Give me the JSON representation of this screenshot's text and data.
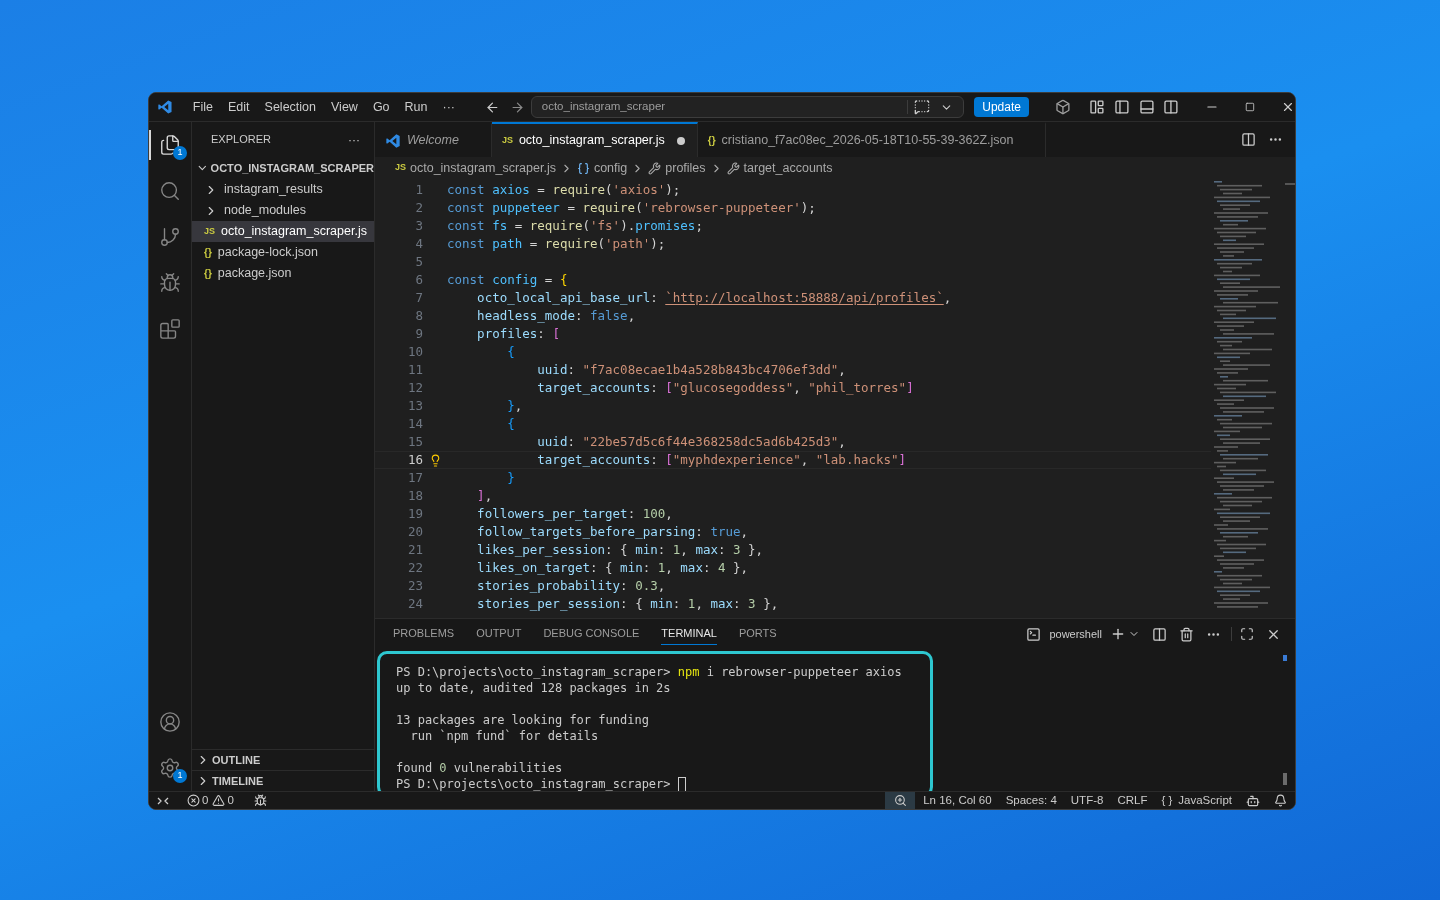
{
  "title_bar": {
    "menu": [
      "File",
      "Edit",
      "Selection",
      "View",
      "Go",
      "Run",
      "···"
    ],
    "command_center": "octo_instagram_scraper",
    "update_button": "Update"
  },
  "activity_bar": {
    "top": [
      {
        "kind": "files",
        "badge": "1",
        "selected": true
      },
      {
        "kind": "search",
        "selected": false
      },
      {
        "kind": "source-control",
        "selected": false
      },
      {
        "kind": "run-debug",
        "selected": false
      },
      {
        "kind": "extensions",
        "selected": false
      }
    ],
    "bottom": [
      {
        "kind": "account"
      },
      {
        "kind": "settings",
        "badge": "1"
      }
    ]
  },
  "sidebar": {
    "title": "EXPLORER",
    "more": "···",
    "root": {
      "label": "OCTO_INSTAGRAM_SCRAPER",
      "expanded": true,
      "children": [
        {
          "label": "instagram_results",
          "kind": "folder",
          "expanded": false,
          "selected": false
        },
        {
          "label": "node_modules",
          "kind": "folder",
          "expanded": false,
          "selected": false
        },
        {
          "label": "octo_instagram_scraper.js",
          "kind": "js",
          "badge": "JS",
          "selected": true
        },
        {
          "label": "package-lock.json",
          "kind": "json",
          "badge": "{}",
          "selected": false
        },
        {
          "label": "package.json",
          "kind": "json",
          "badge": "{}",
          "selected": false
        }
      ]
    },
    "sections": [
      {
        "label": "OUTLINE",
        "expanded": false
      },
      {
        "label": "TIMELINE",
        "expanded": false
      }
    ]
  },
  "tabs": [
    {
      "label": "Welcome",
      "kind": "welcome",
      "selected": false,
      "modified": false
    },
    {
      "label": "octo_instagram_scraper.js",
      "kind": "js",
      "badge": "JS",
      "selected": true,
      "modified": true
    },
    {
      "label": "cristiano_f7ac08ec_2026-05-18T10-55-39-362Z.json",
      "kind": "json",
      "badge": "{}",
      "selected": false,
      "modified": false
    }
  ],
  "breadcrumb": [
    {
      "label": "octo_instagram_scraper.js",
      "kind": "js",
      "badge": "JS"
    },
    {
      "label": "config",
      "kind": "variable"
    },
    {
      "label": "profiles",
      "kind": "property"
    },
    {
      "label": "target_accounts",
      "kind": "property"
    }
  ],
  "code": [
    {
      "number": "1",
      "current": false,
      "tokens": [
        {
          "kind": "keyword",
          "text": "const "
        },
        {
          "kind": "var",
          "text": "axios"
        },
        {
          "kind": "punct",
          "text": " = "
        },
        {
          "kind": "fn",
          "text": "require"
        },
        {
          "kind": "punct",
          "text": "("
        },
        {
          "kind": "str",
          "text": "'axios'"
        },
        {
          "kind": "punct",
          "text": ");"
        }
      ]
    },
    {
      "number": "2",
      "current": false,
      "tokens": [
        {
          "kind": "keyword",
          "text": "const "
        },
        {
          "kind": "var",
          "text": "puppeteer"
        },
        {
          "kind": "punct",
          "text": " = "
        },
        {
          "kind": "fn",
          "text": "require"
        },
        {
          "kind": "punct",
          "text": "("
        },
        {
          "kind": "str",
          "text": "'rebrowser-puppeteer'"
        },
        {
          "kind": "punct",
          "text": ");"
        }
      ]
    },
    {
      "number": "3",
      "current": false,
      "tokens": [
        {
          "kind": "keyword",
          "text": "const "
        },
        {
          "kind": "var",
          "text": "fs"
        },
        {
          "kind": "punct",
          "text": " = "
        },
        {
          "kind": "fn",
          "text": "require"
        },
        {
          "kind": "punct",
          "text": "("
        },
        {
          "kind": "str",
          "text": "'fs'"
        },
        {
          "kind": "punct",
          "text": ")."
        },
        {
          "kind": "var",
          "text": "promises"
        },
        {
          "kind": "punct",
          "text": ";"
        }
      ]
    },
    {
      "number": "4",
      "current": false,
      "tokens": [
        {
          "kind": "keyword",
          "text": "const "
        },
        {
          "kind": "var",
          "text": "path"
        },
        {
          "kind": "punct",
          "text": " = "
        },
        {
          "kind": "fn",
          "text": "require"
        },
        {
          "kind": "punct",
          "text": "("
        },
        {
          "kind": "str",
          "text": "'path'"
        },
        {
          "kind": "punct",
          "text": ");"
        }
      ]
    },
    {
      "number": "5",
      "current": false
    },
    {
      "number": "6",
      "current": false,
      "tokens": [
        {
          "kind": "keyword",
          "text": "const "
        },
        {
          "kind": "var",
          "text": "config"
        },
        {
          "kind": "punct",
          "text": " = "
        },
        {
          "kind": "brace",
          "text": "{"
        }
      ]
    },
    {
      "number": "7",
      "current": false,
      "tokens": [
        {
          "kind": "prop",
          "text": "    octo_local_api_base_url"
        },
        {
          "kind": "punct",
          "text": ": "
        },
        {
          "kind": "link",
          "text": "`http://localhost:58888/api/profiles`"
        },
        {
          "kind": "punct",
          "text": ","
        }
      ]
    },
    {
      "number": "8",
      "current": false,
      "tokens": [
        {
          "kind": "prop",
          "text": "    headless_mode"
        },
        {
          "kind": "punct",
          "text": ": "
        },
        {
          "kind": "bool",
          "text": "false"
        },
        {
          "kind": "punct",
          "text": ","
        }
      ]
    },
    {
      "number": "9",
      "current": false,
      "tokens": [
        {
          "kind": "prop",
          "text": "    profiles"
        },
        {
          "kind": "punct",
          "text": ": "
        },
        {
          "kind": "bracket",
          "text": "["
        }
      ]
    },
    {
      "number": "10",
      "current": false,
      "tokens": [
        {
          "kind": "brace2",
          "text": "        {"
        }
      ]
    },
    {
      "number": "11",
      "current": false,
      "tokens": [
        {
          "kind": "prop",
          "text": "            uuid"
        },
        {
          "kind": "punct",
          "text": ": "
        },
        {
          "kind": "str",
          "text": "\"f7ac08ecae1b4a528b843bc4706ef3dd\""
        },
        {
          "kind": "punct",
          "text": ","
        }
      ]
    },
    {
      "number": "12",
      "current": false,
      "tokens": [
        {
          "kind": "prop",
          "text": "            target_accounts"
        },
        {
          "kind": "punct",
          "text": ": "
        },
        {
          "kind": "bracket",
          "text": "["
        },
        {
          "kind": "str",
          "text": "\"glucosegoddess\""
        },
        {
          "kind": "punct",
          "text": ", "
        },
        {
          "kind": "str",
          "text": "\"phil_torres\""
        },
        {
          "kind": "bracket",
          "text": "]"
        }
      ]
    },
    {
      "number": "13",
      "current": false,
      "tokens": [
        {
          "kind": "brace2",
          "text": "        }"
        },
        {
          "kind": "punct",
          "text": ","
        }
      ]
    },
    {
      "number": "14",
      "current": false,
      "tokens": [
        {
          "kind": "brace2",
          "text": "        {"
        }
      ]
    },
    {
      "number": "15",
      "current": false,
      "tokens": [
        {
          "kind": "prop",
          "text": "            uuid"
        },
        {
          "kind": "punct",
          "text": ": "
        },
        {
          "kind": "str",
          "text": "\"22be57d5c6f44e368258dc5ad6b425d3\""
        },
        {
          "kind": "punct",
          "text": ","
        }
      ]
    },
    {
      "number": "16",
      "current": true,
      "tokens": [
        {
          "kind": "prop",
          "text": "            target_accounts"
        },
        {
          "kind": "punct",
          "text": ": "
        },
        {
          "kind": "bracket",
          "text": "["
        },
        {
          "kind": "str",
          "text": "\"myphdexperience\""
        },
        {
          "kind": "punct",
          "text": ", "
        },
        {
          "kind": "str",
          "text": "\"lab.hacks\""
        },
        {
          "kind": "bracket",
          "text": "]"
        }
      ]
    },
    {
      "number": "17",
      "current": false,
      "tokens": [
        {
          "kind": "brace2",
          "text": "        }"
        }
      ]
    },
    {
      "number": "18",
      "current": false,
      "tokens": [
        {
          "kind": "bracket",
          "text": "    ]"
        },
        {
          "kind": "punct",
          "text": ","
        }
      ]
    },
    {
      "number": "19",
      "current": false,
      "tokens": [
        {
          "kind": "prop",
          "text": "    followers_per_target"
        },
        {
          "kind": "punct",
          "text": ": "
        },
        {
          "kind": "num",
          "text": "100"
        },
        {
          "kind": "punct",
          "text": ","
        }
      ]
    },
    {
      "number": "20",
      "current": false,
      "tokens": [
        {
          "kind": "prop",
          "text": "    follow_targets_before_parsing"
        },
        {
          "kind": "punct",
          "text": ": "
        },
        {
          "kind": "bool",
          "text": "true"
        },
        {
          "kind": "punct",
          "text": ","
        }
      ]
    },
    {
      "number": "21",
      "current": false,
      "tokens": [
        {
          "kind": "prop",
          "text": "    likes_per_session"
        },
        {
          "kind": "punct",
          "text": ": { "
        },
        {
          "kind": "prop",
          "text": "min"
        },
        {
          "kind": "punct",
          "text": ": "
        },
        {
          "kind": "num",
          "text": "1"
        },
        {
          "kind": "punct",
          "text": ", "
        },
        {
          "kind": "prop",
          "text": "max"
        },
        {
          "kind": "punct",
          "text": ": "
        },
        {
          "kind": "num",
          "text": "3"
        },
        {
          "kind": "punct",
          "text": " },"
        }
      ]
    },
    {
      "number": "22",
      "current": false,
      "tokens": [
        {
          "kind": "prop",
          "text": "    likes_on_target"
        },
        {
          "kind": "punct",
          "text": ": { "
        },
        {
          "kind": "prop",
          "text": "min"
        },
        {
          "kind": "punct",
          "text": ": "
        },
        {
          "kind": "num",
          "text": "1"
        },
        {
          "kind": "punct",
          "text": ", "
        },
        {
          "kind": "prop",
          "text": "max"
        },
        {
          "kind": "punct",
          "text": ": "
        },
        {
          "kind": "num",
          "text": "4"
        },
        {
          "kind": "punct",
          "text": " },"
        }
      ]
    },
    {
      "number": "23",
      "current": false,
      "tokens": [
        {
          "kind": "prop",
          "text": "    stories_probability"
        },
        {
          "kind": "punct",
          "text": ": "
        },
        {
          "kind": "num",
          "text": "0.3"
        },
        {
          "kind": "punct",
          "text": ","
        }
      ]
    },
    {
      "number": "24",
      "current": false,
      "tokens": [
        {
          "kind": "prop",
          "text": "    stories_per_session"
        },
        {
          "kind": "punct",
          "text": ": { "
        },
        {
          "kind": "prop",
          "text": "min"
        },
        {
          "kind": "punct",
          "text": ": "
        },
        {
          "kind": "num",
          "text": "1"
        },
        {
          "kind": "punct",
          "text": ", "
        },
        {
          "kind": "prop",
          "text": "max"
        },
        {
          "kind": "punct",
          "text": ": "
        },
        {
          "kind": "num",
          "text": "3"
        },
        {
          "kind": "punct",
          "text": " },"
        }
      ]
    }
  ],
  "panel": {
    "tabs": [
      {
        "label": "PROBLEMS",
        "selected": false
      },
      {
        "label": "OUTPUT",
        "selected": false
      },
      {
        "label": "DEBUG CONSOLE",
        "selected": false
      },
      {
        "label": "TERMINAL",
        "selected": true
      },
      {
        "label": "PORTS",
        "selected": false
      }
    ],
    "terminal_profile": "powershell",
    "terminal": [
      {
        "kind": "output",
        "tokens": [
          {
            "kind": "plain",
            "text": "PS D:\\projects\\octo_instagram_scraper> "
          },
          {
            "kind": "cmd",
            "text": "npm"
          },
          {
            "kind": "plain",
            "text": " i rebrowser-puppeteer axios"
          }
        ]
      },
      {
        "kind": "output",
        "tokens": [
          {
            "kind": "plain",
            "text": "up to date, audited 128 packages in 2s"
          }
        ]
      },
      {
        "kind": "blank"
      },
      {
        "kind": "output",
        "tokens": [
          {
            "kind": "plain",
            "text": "13 packages are looking for funding"
          }
        ]
      },
      {
        "kind": "output",
        "tokens": [
          {
            "kind": "plain",
            "text": "  run `npm fund` for details"
          }
        ]
      },
      {
        "kind": "blank"
      },
      {
        "kind": "output",
        "tokens": [
          {
            "kind": "plain",
            "text": "found "
          },
          {
            "kind": "num",
            "text": "0"
          },
          {
            "kind": "plain",
            "text": " vulnerabilities"
          }
        ]
      },
      {
        "kind": "prompt",
        "tokens": [
          {
            "kind": "prompt",
            "text": "PS D:\\projects\\octo_instagram_scraper> "
          }
        ]
      }
    ]
  },
  "status_bar": {
    "errors": "0",
    "warnings": "0",
    "position": "Ln 16, Col 60",
    "indent": "Spaces: 4",
    "encoding": "UTF-8",
    "eol": "CRLF",
    "language_icon": "{ }",
    "language": "JavaScript"
  }
}
